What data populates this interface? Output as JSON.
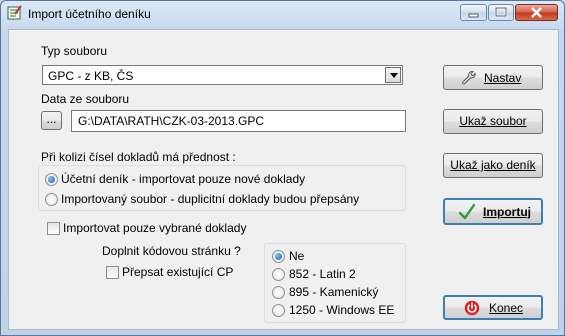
{
  "window": {
    "title": "Import účetního deníku",
    "icon": "ledger-app-icon",
    "controls": [
      "minimize-icon",
      "maximize-icon",
      "close-icon"
    ]
  },
  "file_type": {
    "label": "Typ souboru",
    "selected": "GPC  - z KB, ČS"
  },
  "file_data": {
    "label": "Data ze souboru",
    "browse_label": "...",
    "path": "G:\\DATA\\RATH\\CZK-03-2013.GPC"
  },
  "conflict": {
    "label": "Při kolizi čísel dokladů má přednost :",
    "options": [
      {
        "label": "Účetní deník - importovat pouze nové doklady",
        "selected": true
      },
      {
        "label": "Importovaný soubor - duplicitní doklady budou přepsány",
        "selected": false
      }
    ]
  },
  "import_selected_only": {
    "label": "Importovat pouze vybrané doklady",
    "checked": false
  },
  "codepage": {
    "label": "Doplnit kódovou stránku ?",
    "overwrite_label": "Přepsat existující CP",
    "overwrite_checked": false,
    "options": [
      {
        "label": "Ne",
        "selected": true
      },
      {
        "label": "852 - Latin 2",
        "selected": false
      },
      {
        "label": "895 - Kamenický",
        "selected": false
      },
      {
        "label": "1250 - Windows EE",
        "selected": false
      }
    ]
  },
  "buttons": {
    "settings": "Nastav",
    "show_file": "Ukaž soubor",
    "show_as_journal": "Ukaž jako deník",
    "import": "Importuj",
    "end": "Konec"
  }
}
